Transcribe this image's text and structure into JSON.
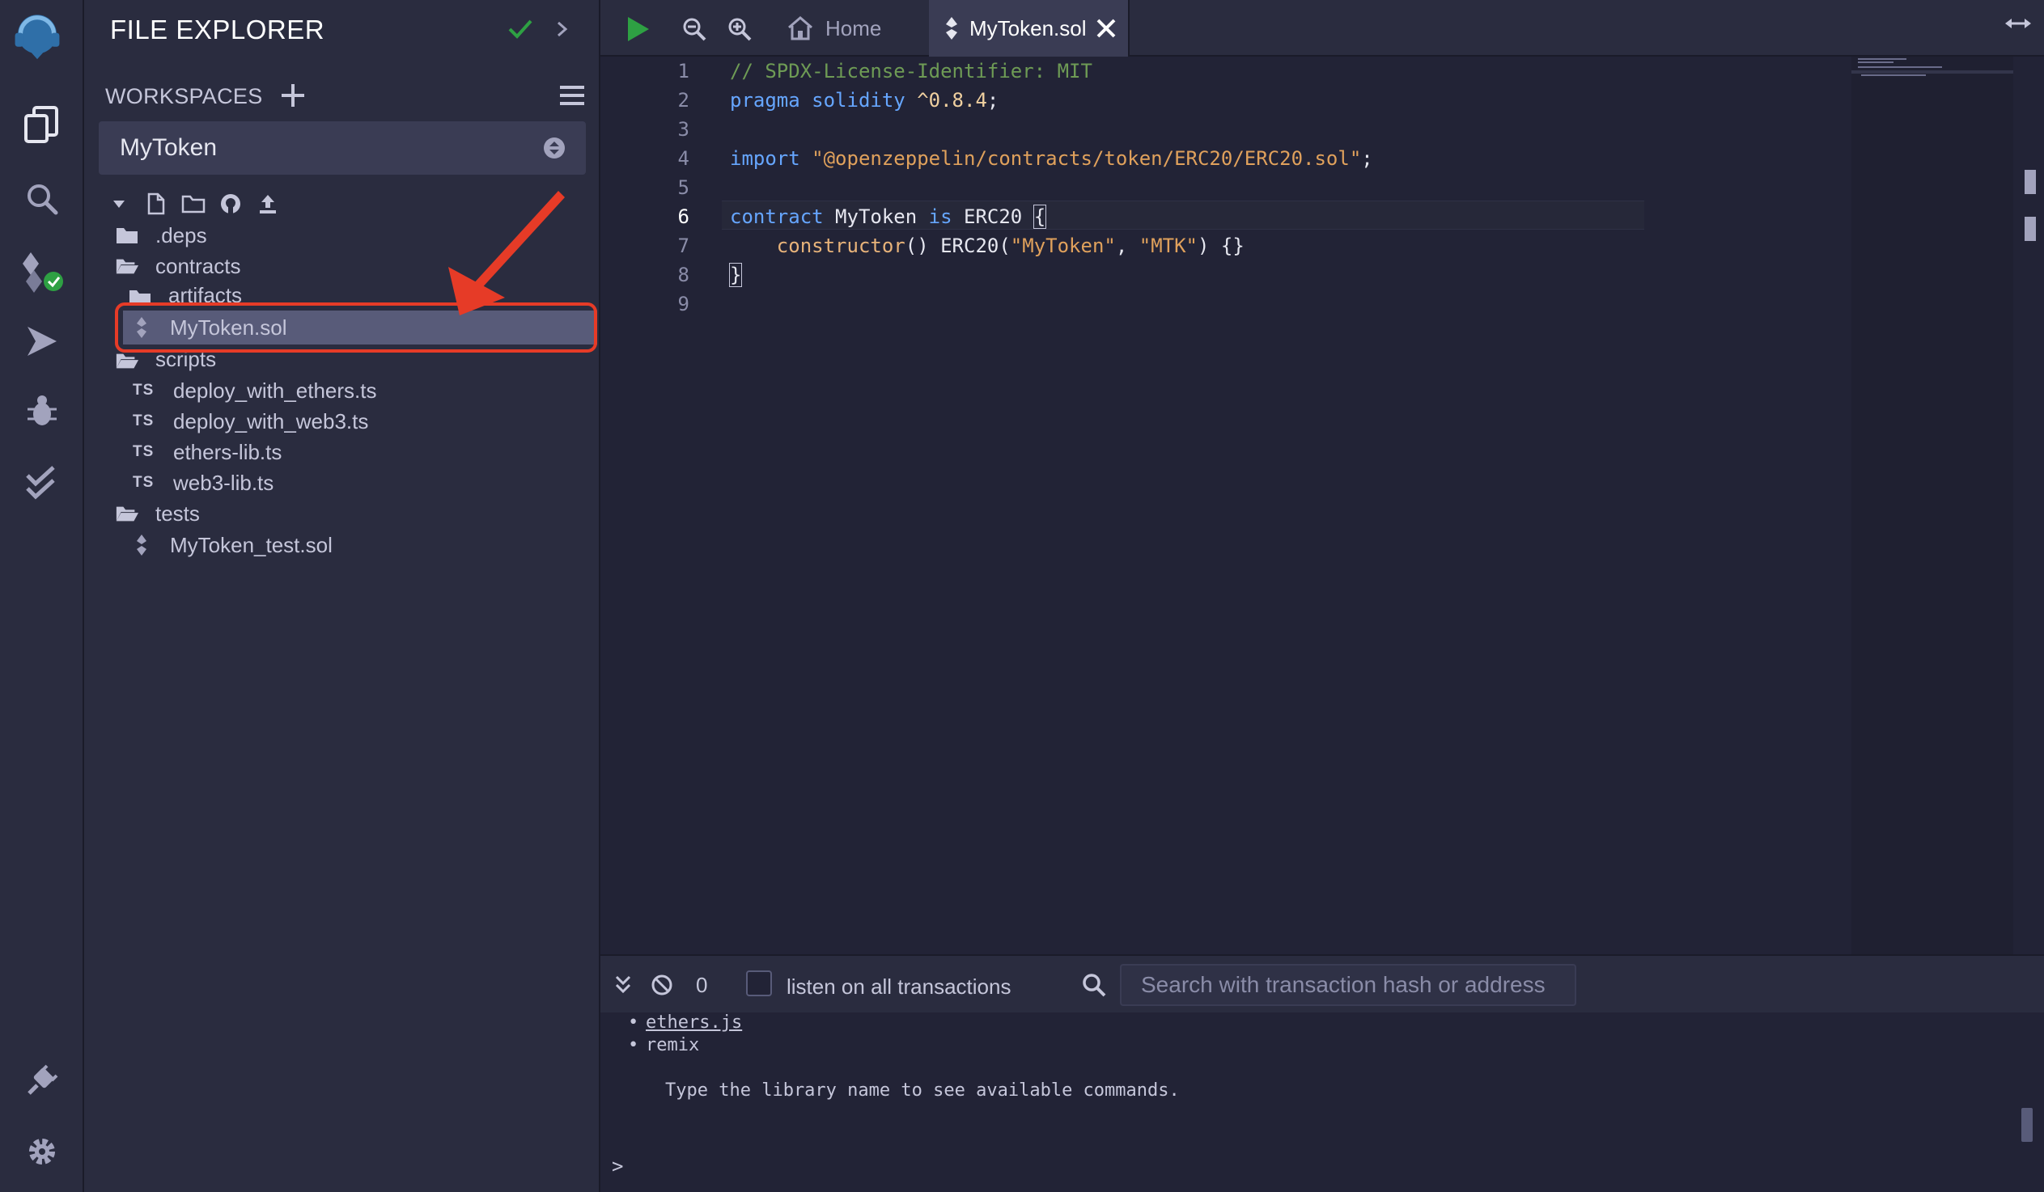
{
  "explorer": {
    "title": "FILE EXPLORER",
    "workspaces_label": "WORKSPACES",
    "workspace_selected": "MyToken",
    "tree": [
      {
        "name": ".deps",
        "kind": "folder"
      },
      {
        "name": "contracts",
        "kind": "folder-open"
      },
      {
        "name": "artifacts",
        "kind": "folder"
      },
      {
        "name": "MyToken.sol",
        "kind": "sol",
        "selected": true
      },
      {
        "name": "scripts",
        "kind": "folder-open"
      },
      {
        "name": "deploy_with_ethers.ts",
        "kind": "ts",
        "badge": "TS"
      },
      {
        "name": "deploy_with_web3.ts",
        "kind": "ts",
        "badge": "TS"
      },
      {
        "name": "ethers-lib.ts",
        "kind": "ts",
        "badge": "TS"
      },
      {
        "name": "web3-lib.ts",
        "kind": "ts",
        "badge": "TS"
      },
      {
        "name": "tests",
        "kind": "folder-open"
      },
      {
        "name": "MyToken_test.sol",
        "kind": "sol"
      }
    ]
  },
  "topbar": {
    "home_tab": "Home",
    "file_tab": "MyToken.sol"
  },
  "editor": {
    "current_line": 6,
    "lines": [
      {
        "n": "1",
        "parts": [
          {
            "t": "// SPDX-License-Identifier: MIT",
            "c": "k-com"
          }
        ]
      },
      {
        "n": "2",
        "parts": [
          {
            "t": "pragma ",
            "c": "k-kw"
          },
          {
            "t": "solidity ",
            "c": "k-kw"
          },
          {
            "t": "^0.8.4",
            "c": "k-ver"
          },
          {
            "t": ";",
            "c": ""
          }
        ]
      },
      {
        "n": "3",
        "parts": []
      },
      {
        "n": "4",
        "parts": [
          {
            "t": "import ",
            "c": "k-kw"
          },
          {
            "t": "\"@openzeppelin/contracts/token/ERC20/ERC20.sol\"",
            "c": "k-str"
          },
          {
            "t": ";",
            "c": ""
          }
        ]
      },
      {
        "n": "5",
        "parts": []
      },
      {
        "n": "6",
        "parts": [
          {
            "t": "contract ",
            "c": "k-kw"
          },
          {
            "t": "MyToken ",
            "c": ""
          },
          {
            "t": "is ",
            "c": "k-kw"
          },
          {
            "t": "ERC20 ",
            "c": ""
          },
          {
            "t": "{",
            "c": "bracket-box"
          }
        ]
      },
      {
        "n": "7",
        "parts": [
          {
            "t": "    constructor",
            "c": "k-fn"
          },
          {
            "t": "() ERC20(",
            "c": ""
          },
          {
            "t": "\"MyToken\"",
            "c": "k-str"
          },
          {
            "t": ", ",
            "c": ""
          },
          {
            "t": "\"MTK\"",
            "c": "k-str"
          },
          {
            "t": ") {}",
            "c": ""
          }
        ]
      },
      {
        "n": "8",
        "parts": [
          {
            "t": "}",
            "c": "bracket-box"
          }
        ]
      },
      {
        "n": "9",
        "parts": []
      }
    ]
  },
  "terminal": {
    "pending_count": "0",
    "listen_label": "listen on all transactions",
    "search_placeholder": "Search with transaction hash or address",
    "libs": [
      "ethers.js",
      "remix"
    ],
    "hint": "Type the library name to see available commands.",
    "prompt": ">"
  },
  "colors": {
    "accent_green": "#2ea043",
    "annotation_red": "#e63b27",
    "selected_row": "#585b79"
  },
  "icons": {
    "rail": [
      "remix-logo-icon",
      "file-explorer-icon",
      "search-icon",
      "solidity-compiler-icon",
      "deploy-run-icon",
      "debugger-icon",
      "unit-test-icon",
      "plugin-manager-icon",
      "settings-icon"
    ]
  }
}
